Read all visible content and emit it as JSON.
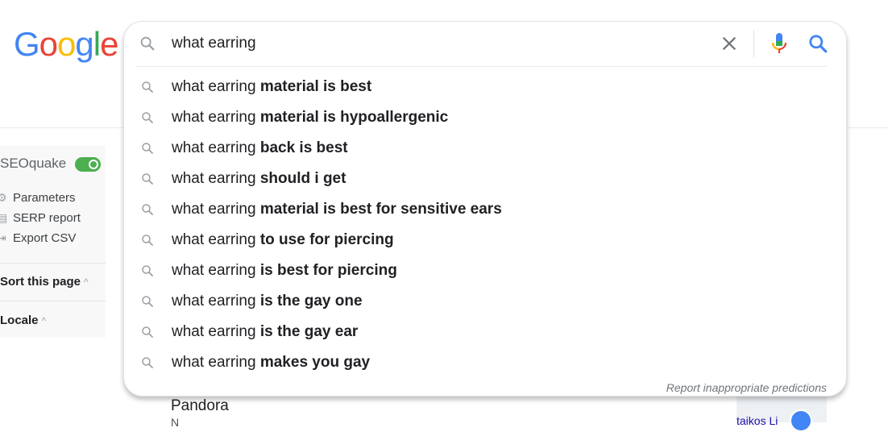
{
  "logo": {
    "letters": [
      {
        "ch": "G",
        "color": "#4285F4"
      },
      {
        "ch": "o",
        "color": "#EA4335"
      },
      {
        "ch": "o",
        "color": "#FBBC05"
      },
      {
        "ch": "g",
        "color": "#4285F4"
      },
      {
        "ch": "l",
        "color": "#34A853"
      },
      {
        "ch": "e",
        "color": "#EA4335"
      }
    ]
  },
  "search": {
    "value": "what earring",
    "suggestions": [
      {
        "prefix": "what earring ",
        "completion": "material is best"
      },
      {
        "prefix": "what earring ",
        "completion": "material is hypoallergenic"
      },
      {
        "prefix": "what earring ",
        "completion": "back is best"
      },
      {
        "prefix": "what earring ",
        "completion": "should i get"
      },
      {
        "prefix": "what earring ",
        "completion": "material is best for sensitive ears"
      },
      {
        "prefix": "what earring ",
        "completion": "to use for piercing"
      },
      {
        "prefix": "what earring ",
        "completion": "is best for piercing"
      },
      {
        "prefix": "what earring ",
        "completion": "is the gay one"
      },
      {
        "prefix": "what earring ",
        "completion": "is the gay ear"
      },
      {
        "prefix": "what earring ",
        "completion": "makes you gay"
      }
    ],
    "report_link": "Report inappropriate predictions",
    "icons": {
      "search": "search-icon",
      "clear": "close-icon",
      "mic": "microphone-icon"
    },
    "colors": {
      "mic_blue": "#4285F4",
      "mic_red": "#EA4335",
      "mic_yellow": "#FBBC05",
      "mic_green": "#34A853",
      "search_blue": "#4285F4"
    }
  },
  "seoquake": {
    "title": "SEOquake",
    "toggle_on": true,
    "items": [
      {
        "label": "Parameters",
        "icon": "gear-icon"
      },
      {
        "label": "SERP report",
        "icon": "report-icon"
      },
      {
        "label": "Export CSV",
        "icon": "export-icon"
      }
    ],
    "sort_label": "Sort this page",
    "locale_label": "Locale"
  },
  "background": {
    "result_title": "Pandora",
    "result_sub": "N",
    "map_text": "taikos Li"
  }
}
